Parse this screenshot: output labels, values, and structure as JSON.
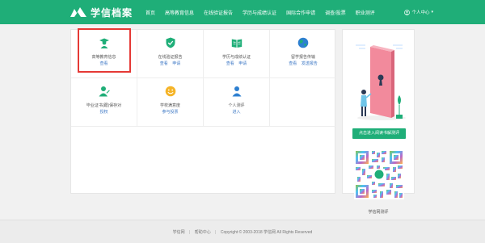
{
  "header": {
    "logo_text": "学信档案",
    "nav": [
      "首页",
      "高等教育信息",
      "在线验证报告",
      "学历与成绩认证",
      "国际合作申请",
      "调查/投票",
      "职业测评"
    ],
    "user_menu": "个人中心"
  },
  "services": [
    {
      "title": "高等教育信息",
      "links": [
        "查看"
      ],
      "icon": "graduate-icon",
      "highlighted": true
    },
    {
      "title": "在线验证报告",
      "links": [
        "查看",
        "申请"
      ],
      "icon": "shield-check-icon"
    },
    {
      "title": "学历与成绩认证",
      "links": [
        "查看",
        "申请"
      ],
      "icon": "book-icon"
    },
    {
      "title": "留学报告传输",
      "links": [
        "查看",
        "发送报告"
      ],
      "icon": "globe-icon"
    },
    {
      "title": "毕业证书(跟)保存对",
      "links": [
        "授权"
      ],
      "icon": "user-edit-icon"
    },
    {
      "title": "学校满意度",
      "links": [
        "参与投票"
      ],
      "icon": "smile-icon"
    },
    {
      "title": "个人测评",
      "links": [
        "进入"
      ],
      "icon": "person-icon"
    }
  ],
  "side": {
    "button": "点击进入阅读书解测评",
    "qr_caption": "学信网测评"
  },
  "footer": {
    "links": [
      "学信网",
      "帮助中心"
    ],
    "copyright": "Copyright © 2003-2018 学信网 All Rights Reserved"
  },
  "colors": {
    "brand": "#1fae78",
    "link": "#3a76c4",
    "highlight": "#e53935"
  }
}
